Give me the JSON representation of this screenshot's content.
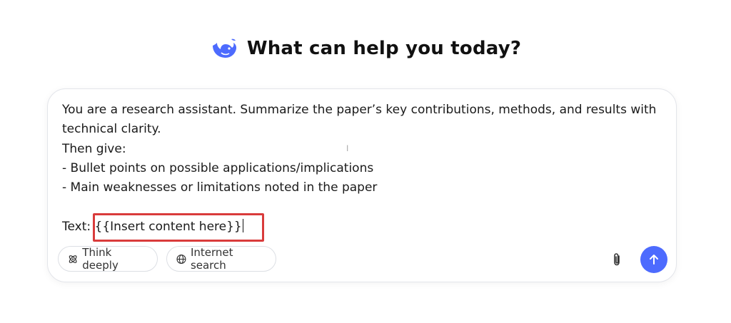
{
  "header": {
    "logo_icon": "deepseek-whale-icon",
    "title": "What can help you today?"
  },
  "composer": {
    "lines": [
      "You are a research assistant. Summarize the paper’s key contributions, methods, and results with",
      "technical clarity.",
      "Then give:",
      "- Bullet points on possible applications/implications",
      "- Main weaknesses or limitations noted in the paper",
      "",
      "Text: {{Insert content here}}"
    ],
    "highlight_color": "#d93b3b"
  },
  "toolbar": {
    "think_label": "Think deeply",
    "think_icon": "atom-icon",
    "search_label": "Internet search",
    "search_icon": "globe-icon",
    "attach_icon": "paperclip-icon",
    "send_icon": "arrow-up-icon",
    "send_color": "#4d6bfe"
  }
}
